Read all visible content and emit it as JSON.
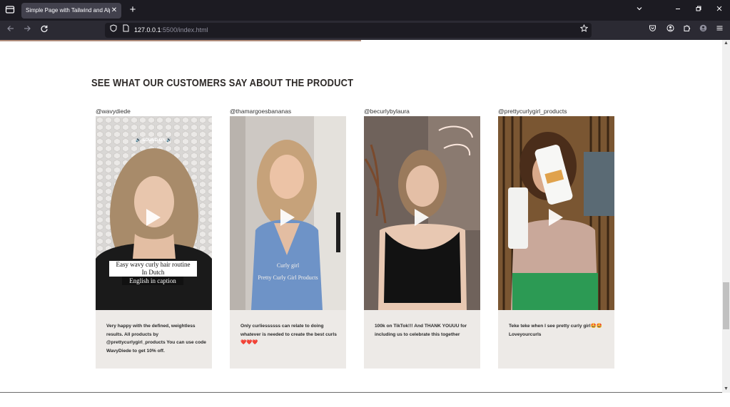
{
  "browser": {
    "tab_title": "Simple Page with Tailwind and Alpine",
    "tab_close_glyph": "✕",
    "new_tab_glyph": "+",
    "url_host": "127.0.0.1",
    "url_rest": ":5500/index.html",
    "icons": [
      "tab-list-icon",
      "back-icon",
      "forward-icon",
      "reload-icon",
      "shield-icon",
      "page-icon",
      "bookmark-star-icon",
      "pocket-icon",
      "account-icon",
      "extensions-icon",
      "profile-icon",
      "menu-icon",
      "minimize-icon",
      "restore-icon",
      "close-icon",
      "chevron-down-icon"
    ]
  },
  "section": {
    "title": "SEE WHAT OUR CUSTOMERS SAY ABOUT THE PRODUCT"
  },
  "cards": [
    {
      "handle": "@wavydiede",
      "overlay_top": "🔊 SOUND ON 🔊",
      "overlay_line1": "Easy wavy curly hair routine",
      "overlay_line2": "In Dutch",
      "overlay_line3": "English in caption",
      "caption": "Very happy with the defined, weightless results. All products by @prettycurlygirl_products You can use code WavyDiede to get 10% off."
    },
    {
      "handle": "@thamargoesbananas",
      "overlay_line1": "Curly girl",
      "overlay_line2": "Pretty Curly Girl Products",
      "caption": "Only curliessssss can relate to doing whatever is needed to create the best curls ❤️❤️❤️"
    },
    {
      "handle": "@becurlybylaura",
      "caption": "100k on TikTok!!! And THANK YOUUU for including us to celebrate this together"
    },
    {
      "handle": "@prettycurlygirl_products",
      "caption": "Teke teke when I see pretty curly girl🤩🤩 Loveyourcurls"
    }
  ],
  "colors": {
    "chrome_dark": "#1c1b22",
    "chrome_nav": "#2b2a33",
    "caption_bg": "#edeae7",
    "title_text": "#2e2a28"
  }
}
